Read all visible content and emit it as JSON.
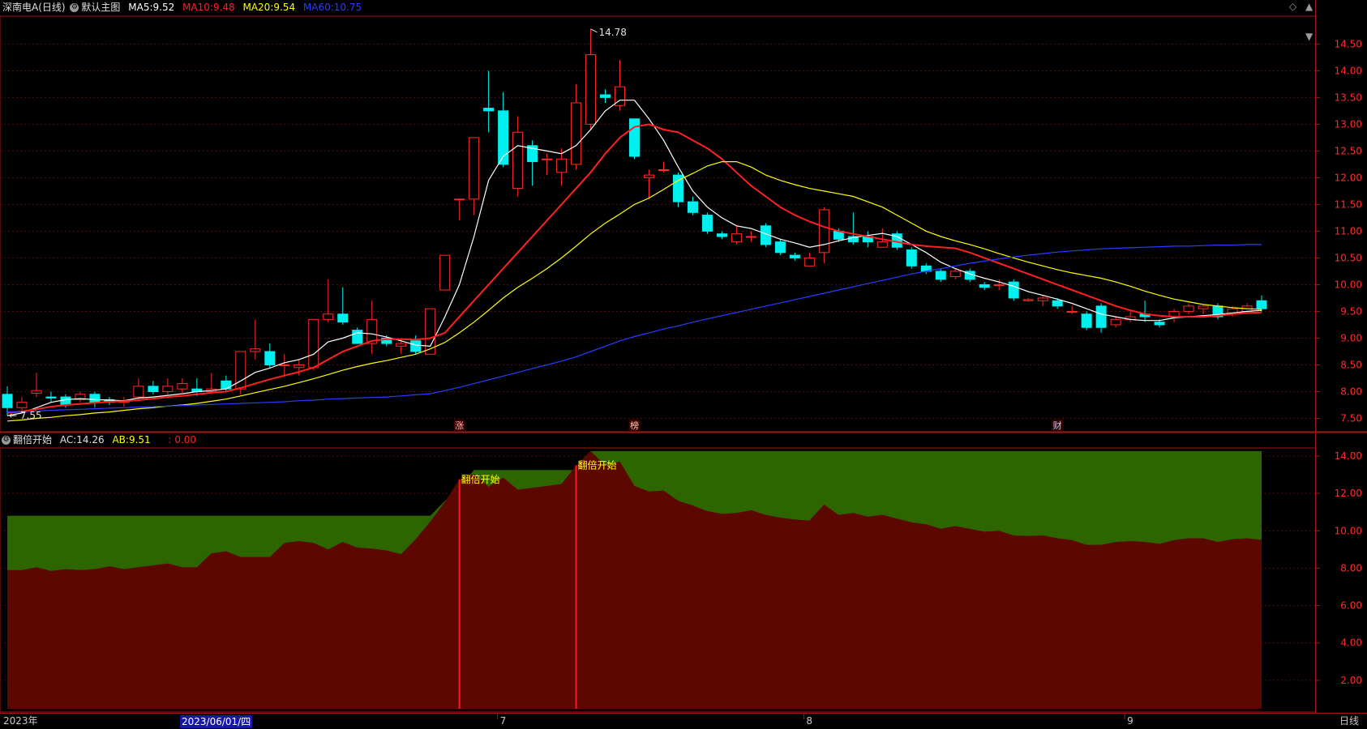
{
  "header": {
    "stock": "深南电A",
    "period": "(日线)",
    "template": "默认主图",
    "ma": [
      {
        "label": "MA5:",
        "value": "9.52",
        "color": "#ffffff"
      },
      {
        "label": "MA10:",
        "value": "9.48",
        "color": "#ff2020"
      },
      {
        "label": "MA20:",
        "value": "9.54",
        "color": "#ffff00"
      },
      {
        "label": "MA60:",
        "value": "10.75",
        "color": "#2a3cff"
      }
    ],
    "controls": [
      "◇",
      "▲",
      "▼"
    ]
  },
  "indicator": {
    "name": "翻倍开始",
    "ac_label": "AC:",
    "ac_value": "14.26",
    "ab_label": "AB:",
    "ab_value": "9.51",
    "extra": ": 0.00",
    "signal_label": "翻倍开始"
  },
  "footer": {
    "year": "2023年",
    "selected_date": "2023/06/01/四",
    "months": [
      "7",
      "8",
      "9"
    ],
    "period_button": "日线"
  },
  "chart_data": [
    {
      "type": "candlestick",
      "title": "深南电A (日线)",
      "y_ticks": [
        7.5,
        8.0,
        8.5,
        9.0,
        9.5,
        10.0,
        10.5,
        11.0,
        11.5,
        12.0,
        12.5,
        13.0,
        13.5,
        14.0,
        14.5
      ],
      "ylim": [
        7.25,
        15.02
      ],
      "grid": true,
      "annotations": {
        "high": "14.78",
        "low": "7.55",
        "markers": [
          "涨",
          "榜",
          "财"
        ]
      },
      "x_labels": [
        "2023年",
        "2023/06/01/四",
        "7",
        "8",
        "9"
      ],
      "candles_ohlc": [
        [
          7.95,
          7.7,
          8.1,
          7.55
        ],
        [
          7.7,
          7.8,
          7.9,
          7.65
        ],
        [
          7.97,
          8.02,
          8.35,
          7.9
        ],
        [
          7.9,
          7.88,
          8.0,
          7.8
        ],
        [
          7.9,
          7.75,
          7.95,
          7.7
        ],
        [
          7.85,
          7.95,
          8.0,
          7.8
        ],
        [
          7.95,
          7.8,
          8.0,
          7.7
        ],
        [
          7.85,
          7.8,
          7.9,
          7.75
        ],
        [
          7.8,
          7.82,
          7.9,
          7.72
        ],
        [
          7.9,
          8.1,
          8.25,
          7.85
        ],
        [
          8.1,
          8.0,
          8.2,
          7.95
        ],
        [
          8.0,
          8.1,
          8.25,
          7.95
        ],
        [
          8.05,
          8.15,
          8.25,
          7.98
        ],
        [
          8.05,
          8.0,
          8.25,
          7.92
        ],
        [
          8.0,
          8.05,
          8.35,
          7.95
        ],
        [
          8.2,
          8.05,
          8.3,
          8.0
        ],
        [
          8.05,
          8.75,
          8.75,
          7.95
        ],
        [
          8.75,
          8.8,
          9.35,
          8.6
        ],
        [
          8.75,
          8.5,
          8.9,
          8.45
        ],
        [
          8.5,
          8.5,
          8.7,
          8.3
        ],
        [
          8.45,
          8.5,
          8.6,
          8.3
        ],
        [
          8.45,
          9.35,
          9.35,
          8.4
        ],
        [
          9.35,
          9.45,
          10.1,
          9.3
        ],
        [
          9.45,
          9.3,
          9.95,
          9.25
        ],
        [
          9.15,
          8.9,
          9.2,
          8.9
        ],
        [
          8.9,
          9.35,
          9.7,
          8.7
        ],
        [
          9.0,
          8.9,
          9.05,
          8.85
        ],
        [
          8.85,
          8.9,
          9.0,
          8.7
        ],
        [
          8.95,
          8.75,
          9.05,
          8.7
        ],
        [
          8.7,
          9.55,
          9.55,
          8.7
        ],
        [
          9.9,
          10.55,
          10.55,
          9.9
        ],
        [
          11.6,
          11.6,
          11.6,
          11.2
        ],
        [
          11.6,
          12.75,
          12.75,
          11.3
        ],
        [
          13.3,
          13.25,
          14.0,
          12.85
        ],
        [
          13.25,
          12.25,
          13.6,
          12.2
        ],
        [
          11.8,
          12.85,
          13.15,
          11.65
        ],
        [
          12.6,
          12.3,
          12.7,
          11.85
        ],
        [
          12.35,
          12.35,
          12.45,
          12.05
        ],
        [
          12.1,
          12.35,
          12.55,
          11.85
        ],
        [
          12.25,
          13.4,
          13.75,
          12.15
        ],
        [
          13.0,
          14.3,
          14.78,
          12.9
        ],
        [
          13.55,
          13.5,
          13.65,
          13.4
        ],
        [
          13.35,
          13.7,
          14.2,
          13.25
        ],
        [
          13.1,
          12.4,
          13.1,
          12.35
        ],
        [
          12.0,
          12.05,
          12.15,
          11.6
        ],
        [
          12.15,
          12.15,
          12.3,
          12.1
        ],
        [
          12.05,
          11.55,
          12.1,
          11.45
        ],
        [
          11.55,
          11.35,
          11.65,
          11.3
        ],
        [
          11.3,
          11.0,
          11.35,
          10.95
        ],
        [
          10.95,
          10.9,
          11.0,
          10.85
        ],
        [
          10.8,
          10.95,
          11.1,
          10.75
        ],
        [
          10.9,
          10.9,
          11.0,
          10.8
        ],
        [
          11.1,
          10.75,
          11.15,
          10.7
        ],
        [
          10.8,
          10.6,
          10.85,
          10.55
        ],
        [
          10.55,
          10.5,
          10.6,
          10.45
        ],
        [
          10.35,
          10.5,
          10.6,
          10.35
        ],
        [
          10.6,
          11.4,
          11.45,
          10.4
        ],
        [
          11.0,
          10.85,
          11.05,
          10.8
        ],
        [
          10.9,
          10.8,
          11.35,
          10.75
        ],
        [
          10.9,
          10.8,
          11.0,
          10.7
        ],
        [
          10.7,
          10.8,
          11.05,
          10.7
        ],
        [
          10.95,
          10.7,
          11.0,
          10.65
        ],
        [
          10.65,
          10.35,
          10.7,
          10.3
        ],
        [
          10.35,
          10.25,
          10.4,
          10.2
        ],
        [
          10.25,
          10.1,
          10.3,
          10.05
        ],
        [
          10.15,
          10.25,
          10.3,
          10.1
        ],
        [
          10.25,
          10.1,
          10.3,
          10.05
        ],
        [
          10.0,
          9.95,
          10.05,
          9.9
        ],
        [
          10.0,
          10.0,
          10.1,
          9.9
        ],
        [
          10.05,
          9.75,
          10.1,
          9.7
        ],
        [
          9.7,
          9.72,
          9.75,
          9.68
        ],
        [
          9.7,
          9.75,
          9.8,
          9.6
        ],
        [
          9.7,
          9.6,
          9.75,
          9.55
        ],
        [
          9.5,
          9.5,
          9.6,
          9.45
        ],
        [
          9.45,
          9.2,
          9.5,
          9.15
        ],
        [
          9.6,
          9.2,
          9.65,
          9.1
        ],
        [
          9.25,
          9.35,
          9.4,
          9.2
        ],
        [
          9.35,
          9.4,
          9.5,
          9.3
        ],
        [
          9.45,
          9.4,
          9.7,
          9.3
        ],
        [
          9.3,
          9.25,
          9.35,
          9.2
        ],
        [
          9.4,
          9.5,
          9.55,
          9.3
        ],
        [
          9.5,
          9.6,
          9.65,
          9.45
        ],
        [
          9.55,
          9.6,
          9.6,
          9.45
        ],
        [
          9.6,
          9.4,
          9.65,
          9.35
        ],
        [
          9.45,
          9.55,
          9.6,
          9.4
        ],
        [
          9.5,
          9.6,
          9.65,
          9.45
        ],
        [
          9.7,
          9.55,
          9.8,
          9.5
        ]
      ],
      "series": [
        {
          "name": "MA5",
          "color": "#ffffff",
          "values": [
            7.55,
            7.6,
            7.7,
            7.8,
            7.85,
            7.87,
            7.85,
            7.84,
            7.83,
            7.88,
            7.9,
            7.93,
            7.96,
            8.0,
            8.02,
            8.05,
            8.2,
            8.36,
            8.44,
            8.54,
            8.6,
            8.7,
            8.93,
            9.0,
            9.1,
            9.08,
            9.02,
            8.95,
            8.87,
            8.85,
            9.4,
            10.0,
            10.9,
            11.95,
            12.4,
            12.6,
            12.55,
            12.5,
            12.45,
            12.6,
            12.9,
            13.25,
            13.45,
            13.45,
            13.1,
            12.7,
            12.2,
            11.75,
            11.45,
            11.25,
            11.1,
            11.05,
            10.95,
            10.85,
            10.78,
            10.7,
            10.75,
            10.82,
            10.88,
            10.92,
            10.96,
            10.9,
            10.75,
            10.6,
            10.42,
            10.3,
            10.2,
            10.12,
            10.05,
            9.97,
            9.87,
            9.8,
            9.73,
            9.65,
            9.55,
            9.45,
            9.4,
            9.35,
            9.33,
            9.33,
            9.38,
            9.4,
            9.42,
            9.44,
            9.47,
            9.5,
            9.52
          ]
        },
        {
          "name": "MA10",
          "color": "#ff2020",
          "values": [
            7.6,
            7.63,
            7.67,
            7.72,
            7.75,
            7.77,
            7.79,
            7.81,
            7.82,
            7.84,
            7.87,
            7.9,
            7.92,
            7.95,
            7.98,
            8.0,
            8.07,
            8.15,
            8.23,
            8.3,
            8.37,
            8.45,
            8.6,
            8.75,
            8.85,
            8.95,
            8.98,
            8.98,
            8.97,
            9.0,
            9.1,
            9.4,
            9.7,
            10.0,
            10.3,
            10.6,
            10.9,
            11.2,
            11.5,
            11.8,
            12.1,
            12.45,
            12.75,
            12.95,
            13.0,
            12.9,
            12.85,
            12.7,
            12.55,
            12.35,
            12.1,
            11.85,
            11.65,
            11.45,
            11.3,
            11.18,
            11.08,
            11.0,
            10.95,
            10.9,
            10.85,
            10.8,
            10.75,
            10.72,
            10.7,
            10.68,
            10.6,
            10.5,
            10.4,
            10.3,
            10.2,
            10.1,
            10.0,
            9.9,
            9.8,
            9.7,
            9.6,
            9.52,
            9.45,
            9.42,
            9.4,
            9.4,
            9.4,
            9.42,
            9.45,
            9.47,
            9.48
          ]
        },
        {
          "name": "MA20",
          "color": "#ffff00",
          "values": [
            7.45,
            7.47,
            7.5,
            7.52,
            7.55,
            7.57,
            7.6,
            7.62,
            7.65,
            7.68,
            7.7,
            7.73,
            7.75,
            7.78,
            7.82,
            7.86,
            7.92,
            7.98,
            8.04,
            8.1,
            8.17,
            8.24,
            8.32,
            8.4,
            8.47,
            8.53,
            8.58,
            8.64,
            8.7,
            8.8,
            8.92,
            9.1,
            9.3,
            9.52,
            9.75,
            9.95,
            10.12,
            10.3,
            10.5,
            10.72,
            10.95,
            11.15,
            11.32,
            11.5,
            11.62,
            11.78,
            11.95,
            12.08,
            12.22,
            12.3,
            12.3,
            12.2,
            12.05,
            11.95,
            11.87,
            11.8,
            11.75,
            11.7,
            11.65,
            11.55,
            11.45,
            11.3,
            11.15,
            11.0,
            10.9,
            10.82,
            10.75,
            10.67,
            10.58,
            10.5,
            10.42,
            10.35,
            10.28,
            10.22,
            10.17,
            10.12,
            10.05,
            9.97,
            9.88,
            9.8,
            9.73,
            9.68,
            9.63,
            9.6,
            9.57,
            9.55,
            9.54
          ]
        },
        {
          "name": "MA60",
          "color": "#2a3cff",
          "values": [
            7.62,
            7.63,
            7.64,
            7.65,
            7.66,
            7.67,
            7.68,
            7.69,
            7.7,
            7.71,
            7.72,
            7.73,
            7.74,
            7.75,
            7.76,
            7.77,
            7.78,
            7.79,
            7.8,
            7.81,
            7.83,
            7.84,
            7.86,
            7.87,
            7.88,
            7.89,
            7.9,
            7.92,
            7.94,
            7.96,
            8.02,
            8.08,
            8.15,
            8.22,
            8.29,
            8.36,
            8.43,
            8.5,
            8.57,
            8.65,
            8.75,
            8.85,
            8.95,
            9.03,
            9.1,
            9.17,
            9.23,
            9.3,
            9.36,
            9.42,
            9.48,
            9.54,
            9.6,
            9.66,
            9.72,
            9.78,
            9.84,
            9.9,
            9.96,
            10.02,
            10.08,
            10.14,
            10.2,
            10.25,
            10.3,
            10.35,
            10.4,
            10.44,
            10.48,
            10.52,
            10.55,
            10.58,
            10.61,
            10.63,
            10.65,
            10.67,
            10.68,
            10.69,
            10.7,
            10.71,
            10.72,
            10.72,
            10.73,
            10.74,
            10.74,
            10.75,
            10.75
          ]
        }
      ]
    },
    {
      "type": "area",
      "title": "翻倍开始",
      "y_ticks": [
        2.0,
        4.0,
        6.0,
        8.0,
        10.0,
        12.0,
        14.0
      ],
      "ylim": [
        0.48,
        14.43
      ],
      "grid": true,
      "series": [
        {
          "name": "AC",
          "color": "#2d6600",
          "values": [
            10.8,
            10.8,
            10.8,
            10.8,
            10.8,
            10.8,
            10.8,
            10.8,
            10.8,
            10.8,
            10.8,
            10.8,
            10.8,
            10.8,
            10.8,
            10.8,
            10.8,
            10.8,
            10.8,
            10.8,
            10.8,
            10.8,
            10.8,
            10.8,
            10.8,
            10.8,
            10.8,
            10.8,
            10.8,
            10.8,
            11.6,
            12.3,
            13.25,
            13.25,
            13.25,
            13.25,
            13.25,
            13.25,
            13.25,
            13.25,
            14.26,
            14.26,
            14.26,
            14.26,
            14.26,
            14.26,
            14.26,
            14.26,
            14.26,
            14.26,
            14.26,
            14.26,
            14.26,
            14.26,
            14.26,
            14.26,
            14.26,
            14.26,
            14.26,
            14.26,
            14.26,
            14.26,
            14.26,
            14.26,
            14.26,
            14.26,
            14.26,
            14.26,
            14.26,
            14.26,
            14.26,
            14.26,
            14.26,
            14.26,
            14.26,
            14.26,
            14.26,
            14.26,
            14.26,
            14.26,
            14.26,
            14.26,
            14.26,
            14.26,
            14.26,
            14.26,
            14.26
          ]
        },
        {
          "name": "AB",
          "color": "#5c0800",
          "values": [
            7.9,
            7.9,
            8.05,
            7.85,
            7.95,
            7.9,
            7.95,
            8.1,
            7.95,
            8.05,
            8.15,
            8.25,
            8.05,
            8.05,
            8.8,
            8.9,
            8.6,
            8.6,
            8.6,
            9.35,
            9.45,
            9.35,
            9.0,
            9.4,
            9.1,
            9.05,
            8.95,
            8.75,
            9.55,
            10.5,
            11.55,
            12.75,
            13.05,
            12.35,
            12.85,
            12.2,
            12.3,
            12.4,
            12.5,
            13.5,
            14.26,
            13.5,
            13.7,
            12.4,
            12.1,
            12.15,
            11.6,
            11.35,
            11.05,
            10.9,
            10.95,
            11.1,
            10.85,
            10.7,
            10.6,
            10.55,
            11.4,
            10.85,
            10.95,
            10.75,
            10.85,
            10.65,
            10.45,
            10.35,
            10.1,
            10.25,
            10.1,
            9.95,
            10.0,
            9.75,
            9.72,
            9.75,
            9.6,
            9.5,
            9.25,
            9.25,
            9.4,
            9.45,
            9.4,
            9.3,
            9.5,
            9.6,
            9.6,
            9.4,
            9.55,
            9.6,
            9.51
          ]
        }
      ],
      "signals": [
        31,
        39
      ]
    }
  ]
}
